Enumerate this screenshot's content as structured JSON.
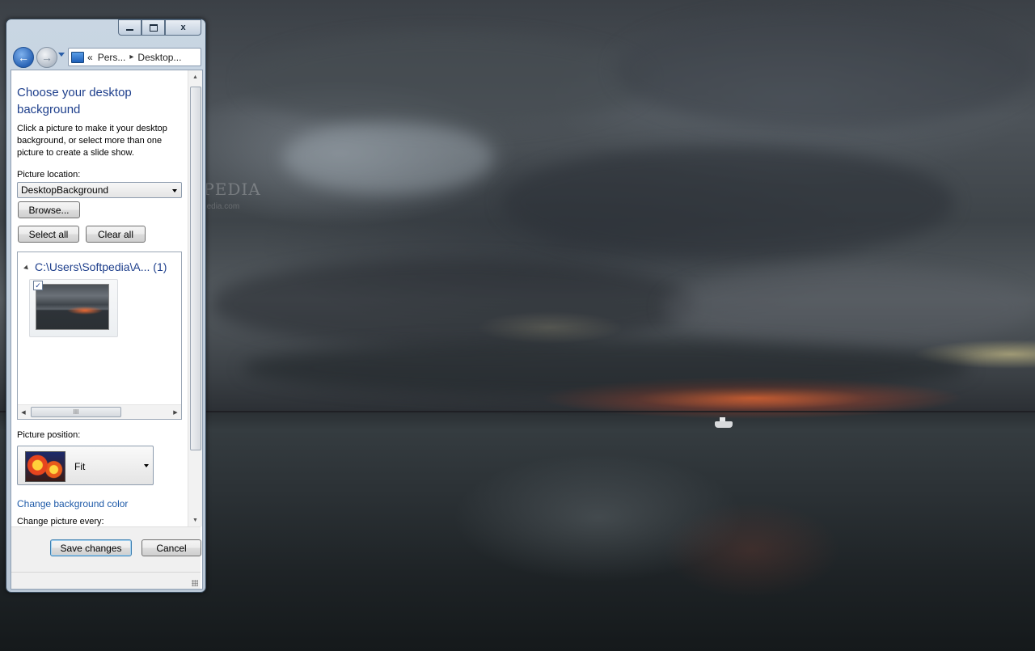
{
  "window": {
    "caption_buttons": [
      "minimize",
      "maximize",
      "close"
    ],
    "close_glyph": "x"
  },
  "navbar": {
    "back_glyph": "←",
    "forward_glyph": "→",
    "breadcrumb": [
      "Pers...",
      "Desktop..."
    ],
    "overflow": "«",
    "separator": "▸",
    "icon": "control-panel-icon"
  },
  "page": {
    "title": "Choose your desktop background",
    "description": "Click a picture to make it your desktop background, or select more than one picture to create a slide show.",
    "picture_location_label": "Picture location:",
    "picture_location_value": "DesktopBackground",
    "browse_label": "Browse...",
    "select_all_label": "Select all",
    "clear_all_label": "Clear all",
    "group_title": "C:\\Users\\Softpedia\\A... (1)",
    "thumbnail_checked": "✓",
    "hscroll_grip": "III",
    "picture_position_label": "Picture position:",
    "picture_position_value": "Fit",
    "change_color_link": "Change background color",
    "change_picture_label": "Change picture every:",
    "save_label": "Save changes",
    "cancel_label": "Cancel"
  },
  "desktop": {
    "watermark": "SOFTPEDIA",
    "watermark_sub": "www.softpedia.com"
  },
  "colors": {
    "title_blue": "#1e3f8c",
    "link_blue": "#1e5aa8",
    "sunset": "#ff6e32"
  }
}
